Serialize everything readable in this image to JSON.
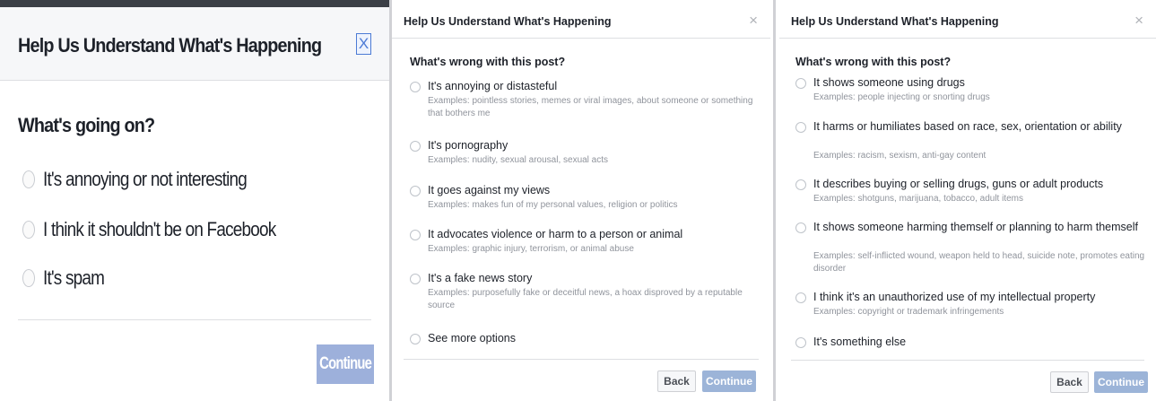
{
  "panel1": {
    "title": "Help Us Understand What's Happening",
    "close_glyph": "X",
    "question": "What's going on?",
    "options": [
      {
        "label": "It's annoying or not interesting"
      },
      {
        "label": "I think it shouldn't be on Facebook"
      },
      {
        "label": "It's spam"
      }
    ],
    "continue_label": "Continue"
  },
  "panel2": {
    "title": "Help Us Understand What's Happening",
    "close_glyph": "×",
    "question": "What's wrong with this post?",
    "options": [
      {
        "label": "It's annoying or distasteful",
        "example": "Examples: pointless stories, memes or viral images, about someone or something that bothers me"
      },
      {
        "label": "It's pornography",
        "example": "Examples: nudity, sexual arousal, sexual acts"
      },
      {
        "label": "It goes against my views",
        "example": "Examples: makes fun of my personal values, religion or politics"
      },
      {
        "label": "It advocates violence or harm to a person or animal",
        "example": "Examples: graphic injury, terrorism, or animal abuse"
      },
      {
        "label": "It's a fake news story",
        "example": "Examples: purposefully fake or deceitful news, a hoax disproved by a reputable source"
      },
      {
        "label": "See more options",
        "example": ""
      }
    ],
    "back_label": "Back",
    "continue_label": "Continue"
  },
  "panel3": {
    "title": "Help Us Understand What's Happening",
    "close_glyph": "×",
    "question": "What's wrong with this post?",
    "options": [
      {
        "label": "It shows someone using drugs",
        "example": "Examples: people injecting or snorting drugs"
      },
      {
        "label": "It harms or humiliates based on race, sex, orientation or ability",
        "example": "Examples: racism, sexism, anti-gay content"
      },
      {
        "label": "It describes buying or selling drugs, guns or adult products",
        "example": "Examples: shotguns, marijuana, tobacco, adult items"
      },
      {
        "label": "It shows someone harming themself or planning to harm themself",
        "example": "Examples: self-inflicted wound, weapon held to head, suicide note, promotes eating disorder"
      },
      {
        "label": "I think it's an unauthorized use of my intellectual property",
        "example": "Examples: copyright or trademark infringements"
      },
      {
        "label": "It's something else",
        "example": ""
      }
    ],
    "back_label": "Back",
    "continue_label": "Continue"
  },
  "colors": {
    "title_text": "#1d2129",
    "example_text": "#90949c",
    "continue_disabled": "#9cb4d8",
    "border": "#dddfe2"
  }
}
